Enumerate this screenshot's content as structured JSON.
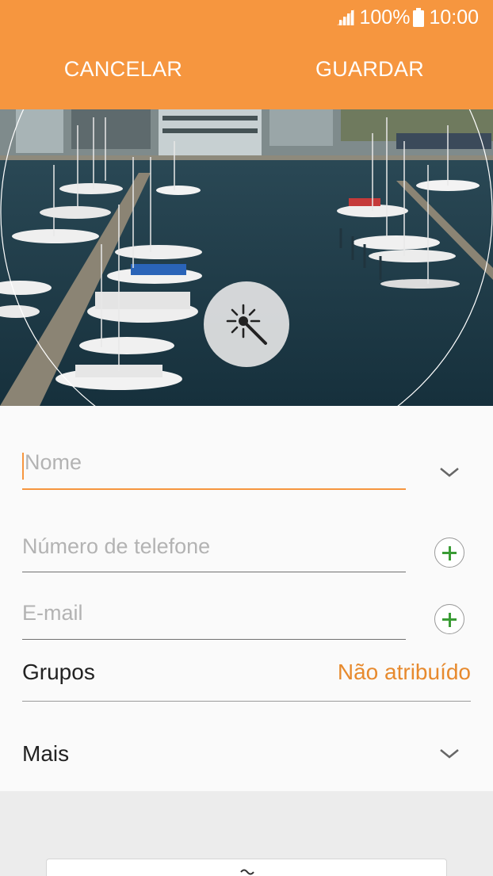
{
  "status_bar": {
    "battery": "100%",
    "time": "10:00"
  },
  "header": {
    "cancel_label": "CANCELAR",
    "save_label": "GUARDAR"
  },
  "form": {
    "name_placeholder": "Nome",
    "phone_placeholder": "Número de telefone",
    "email_placeholder": "E-mail",
    "groups_label": "Grupos",
    "groups_value": "Não atribuído",
    "more_label": "Mais"
  },
  "icons": {
    "signal": "signal-icon",
    "battery": "battery-icon",
    "magic": "magic-wand-icon",
    "chevron": "chevron-down-icon",
    "plus": "add-icon"
  },
  "colors": {
    "accent": "#f6963f",
    "accent_text": "#e78a2e",
    "add_green": "#3a9c35"
  }
}
